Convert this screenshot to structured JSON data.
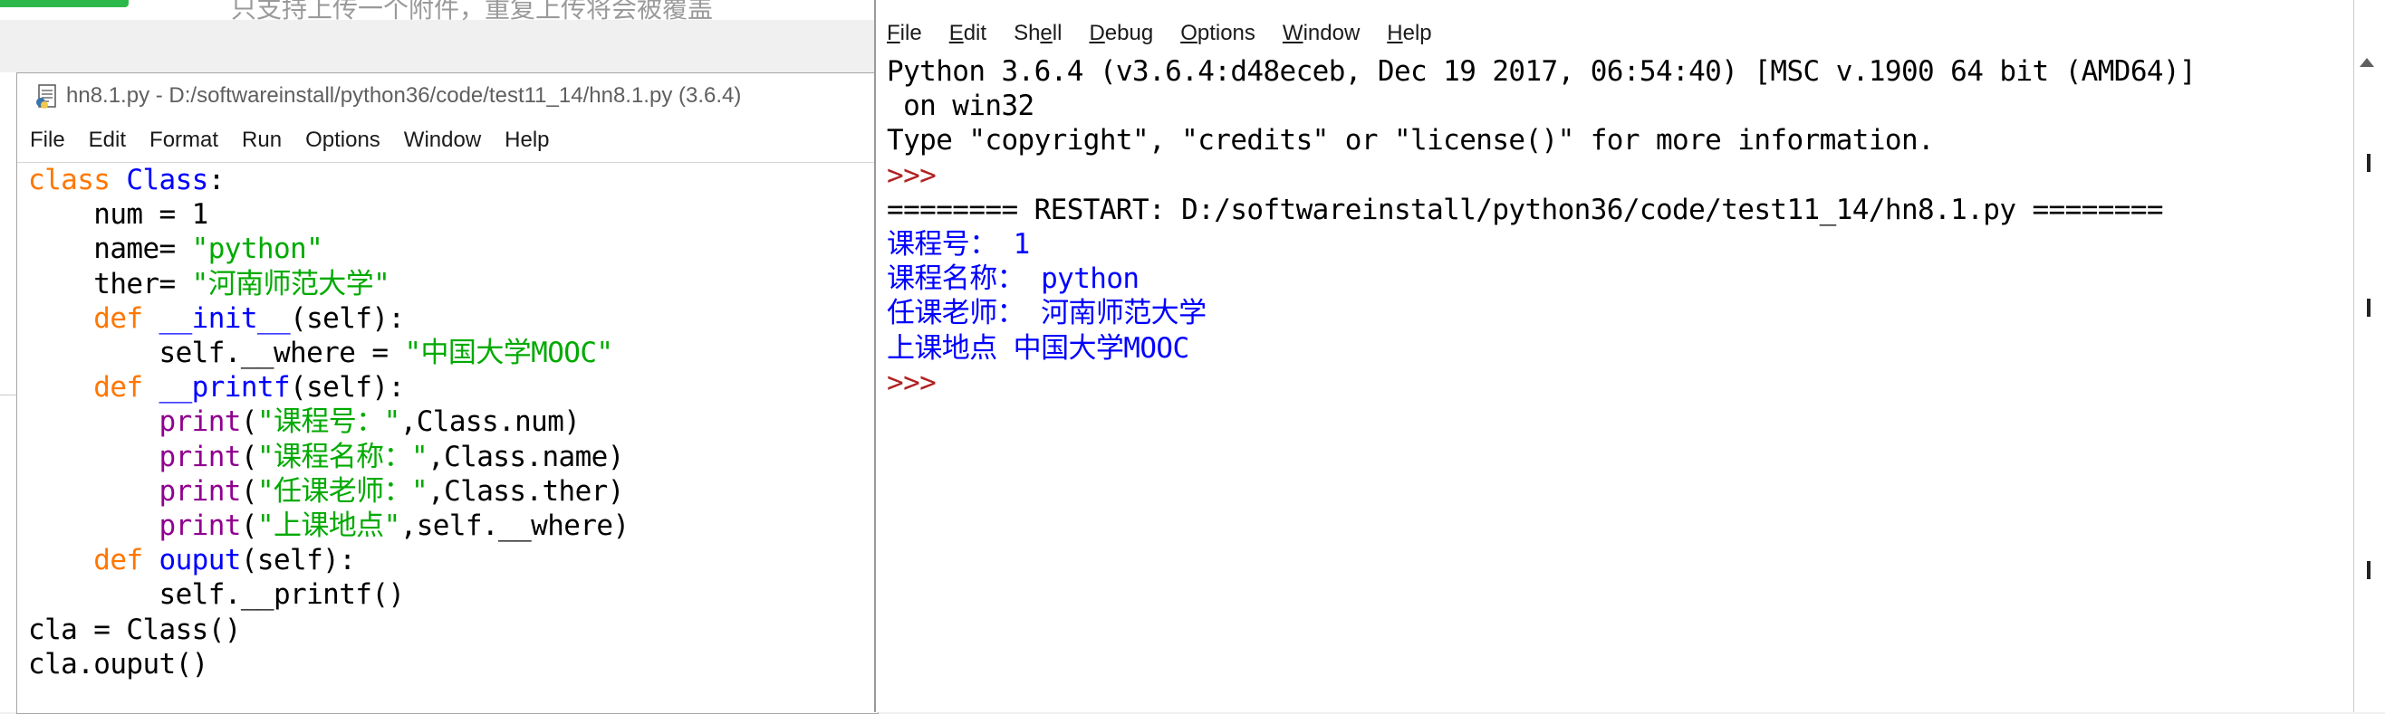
{
  "background": {
    "top_hint": "只支持上传一个附件，重复上传将会被覆盖"
  },
  "editor": {
    "title": "hn8.1.py - D:/softwareinstall/python36/code/test11_14/hn8.1.py (3.6.4)",
    "menu": [
      "File",
      "Edit",
      "Format",
      "Run",
      "Options",
      "Window",
      "Help"
    ],
    "code": [
      [
        [
          "kw",
          "class "
        ],
        [
          "def",
          "Class"
        ],
        [
          "blk",
          ":"
        ]
      ],
      [
        [
          "blk",
          "    num = 1"
        ]
      ],
      [
        [
          "blk",
          "    name= "
        ],
        [
          "str",
          "\"python\""
        ]
      ],
      [
        [
          "blk",
          "    ther= "
        ],
        [
          "str",
          "\"河南师范大学\""
        ]
      ],
      [
        [
          "kw",
          "    def "
        ],
        [
          "def",
          "__init__"
        ],
        [
          "blk",
          "(self):"
        ]
      ],
      [
        [
          "blk",
          "        self.__where = "
        ],
        [
          "str",
          "\"中国大学MOOC\""
        ]
      ],
      [
        [
          "kw",
          "    def "
        ],
        [
          "def",
          "__printf"
        ],
        [
          "blk",
          "(self):"
        ]
      ],
      [
        [
          "bi",
          "        print"
        ],
        [
          "blk",
          "("
        ],
        [
          "str",
          "\"课程号：\""
        ],
        [
          "blk",
          ",Class.num)"
        ]
      ],
      [
        [
          "bi",
          "        print"
        ],
        [
          "blk",
          "("
        ],
        [
          "str",
          "\"课程名称：\""
        ],
        [
          "blk",
          ",Class.name)"
        ]
      ],
      [
        [
          "bi",
          "        print"
        ],
        [
          "blk",
          "("
        ],
        [
          "str",
          "\"任课老师：\""
        ],
        [
          "blk",
          ",Class.ther)"
        ]
      ],
      [
        [
          "bi",
          "        print"
        ],
        [
          "blk",
          "("
        ],
        [
          "str",
          "\"上课地点\""
        ],
        [
          "blk",
          ",self.__where)"
        ]
      ],
      [
        [
          "kw",
          "    def "
        ],
        [
          "def",
          "ouput"
        ],
        [
          "blk",
          "(self):"
        ]
      ],
      [
        [
          "blk",
          "        self.__printf()"
        ]
      ],
      [
        [
          "blk",
          "cla = Class()"
        ]
      ],
      [
        [
          "blk",
          "cla.ouput()"
        ]
      ]
    ]
  },
  "shell": {
    "menu": [
      {
        "first": "F",
        "rest": "ile"
      },
      {
        "first": "E",
        "rest": "dit"
      },
      {
        "first": "Sh",
        "rest": "e",
        "tail": "ll",
        "underline_mid": true
      },
      {
        "first": "D",
        "rest": "ebug"
      },
      {
        "first": "O",
        "rest": "ptions"
      },
      {
        "first": "W",
        "rest": "indow"
      },
      {
        "first": "H",
        "rest": "elp"
      }
    ],
    "output": [
      [
        [
          "blk",
          "Python 3.6.4 (v3.6.4:d48eceb, Dec 19 2017, 06:54:40) [MSC v.1900 64 bit (AMD64)]"
        ]
      ],
      [
        [
          "blk",
          " on win32"
        ]
      ],
      [
        [
          "blk",
          "Type \"copyright\", \"credits\" or \"license()\" for more information."
        ]
      ],
      [
        [
          "prompt",
          ">>>"
        ]
      ],
      [
        [
          "blk",
          "======== RESTART: D:/softwareinstall/python36/code/test11_14/hn8.1.py ========"
        ]
      ],
      [
        [
          "blue",
          "课程号： 1"
        ]
      ],
      [
        [
          "blue",
          "课程名称： python"
        ]
      ],
      [
        [
          "blue",
          "任课老师： 河南师范大学"
        ]
      ],
      [
        [
          "blue",
          "上课地点 中国大学MOOC"
        ]
      ],
      [
        [
          "prompt",
          ">>> "
        ]
      ]
    ]
  },
  "colors": {
    "keyword": "#ff7700",
    "definition": "#0000ff",
    "string": "#00aa00",
    "builtin": "#900090",
    "stdout": "#0000ff",
    "prompt": "#b22222"
  }
}
